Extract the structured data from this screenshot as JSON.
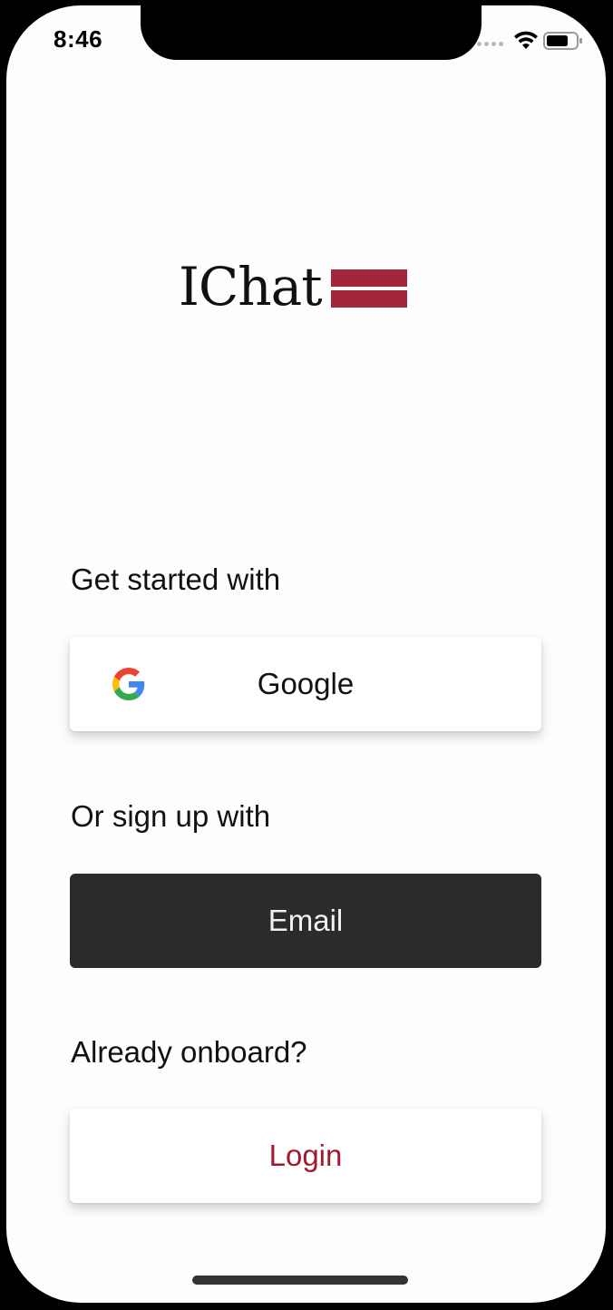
{
  "status_bar": {
    "time": "8:46"
  },
  "logo": {
    "text": "IChat",
    "flag_colors": [
      "#a3263a",
      "#fdfdfd",
      "#a3263a"
    ]
  },
  "sections": {
    "get_started_label": "Get started with",
    "signup_label": "Or sign up with",
    "already_label": "Already onboard?"
  },
  "buttons": {
    "google_label": "Google",
    "email_label": "Email",
    "login_label": "Login"
  },
  "icons": {
    "google": "google-icon",
    "wifi": "wifi-icon",
    "battery": "battery-icon"
  },
  "colors": {
    "accent": "#a3192e",
    "dark_button": "#2b2b2b",
    "background": "#fdfdfd"
  }
}
